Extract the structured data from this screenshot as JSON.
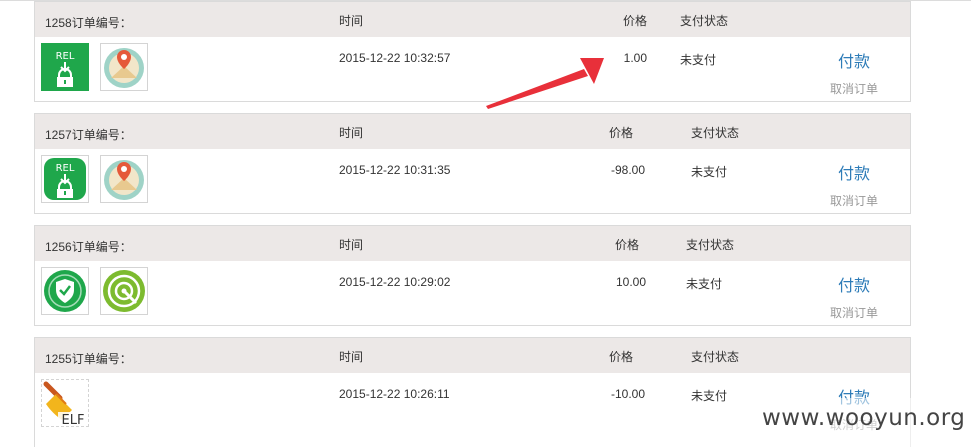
{
  "headers": {
    "order_no_suffix": "订单编号：",
    "time": "时间",
    "price": "价格",
    "status": "支付状态"
  },
  "actions": {
    "pay": "付款",
    "cancel": "取消订单"
  },
  "orders": [
    {
      "order_label": "1258订单编号：",
      "time": "2015-12-22 10:32:57",
      "price": "1.00",
      "status": "未支付",
      "icons": [
        "rel-lock-app-icon",
        "map-pin-app-icon"
      ]
    },
    {
      "order_label": "1257订单编号：",
      "time": "2015-12-22 10:31:35",
      "price": "-98.00",
      "status": "未支付",
      "icons": [
        "rel-lock-app-icon",
        "map-pin-app-icon"
      ]
    },
    {
      "order_label": "1256订单编号：",
      "time": "2015-12-22 10:29:02",
      "price": "10.00",
      "status": "未支付",
      "icons": [
        "shield-app-icon",
        "radar-app-icon"
      ]
    },
    {
      "order_label": "1255订单编号：",
      "time": "2015-12-22 10:26:11",
      "price": "-10.00",
      "status": "未支付",
      "icons": [
        "elf-brush-app-icon"
      ]
    }
  ],
  "watermark": "www.wooyun.org",
  "colors": {
    "header_bg": "#ece8e7",
    "pay_link": "#2e7cb8",
    "cancel_link": "#999999",
    "arrow": "#e8303a",
    "icon_green": "#1fa74b"
  }
}
